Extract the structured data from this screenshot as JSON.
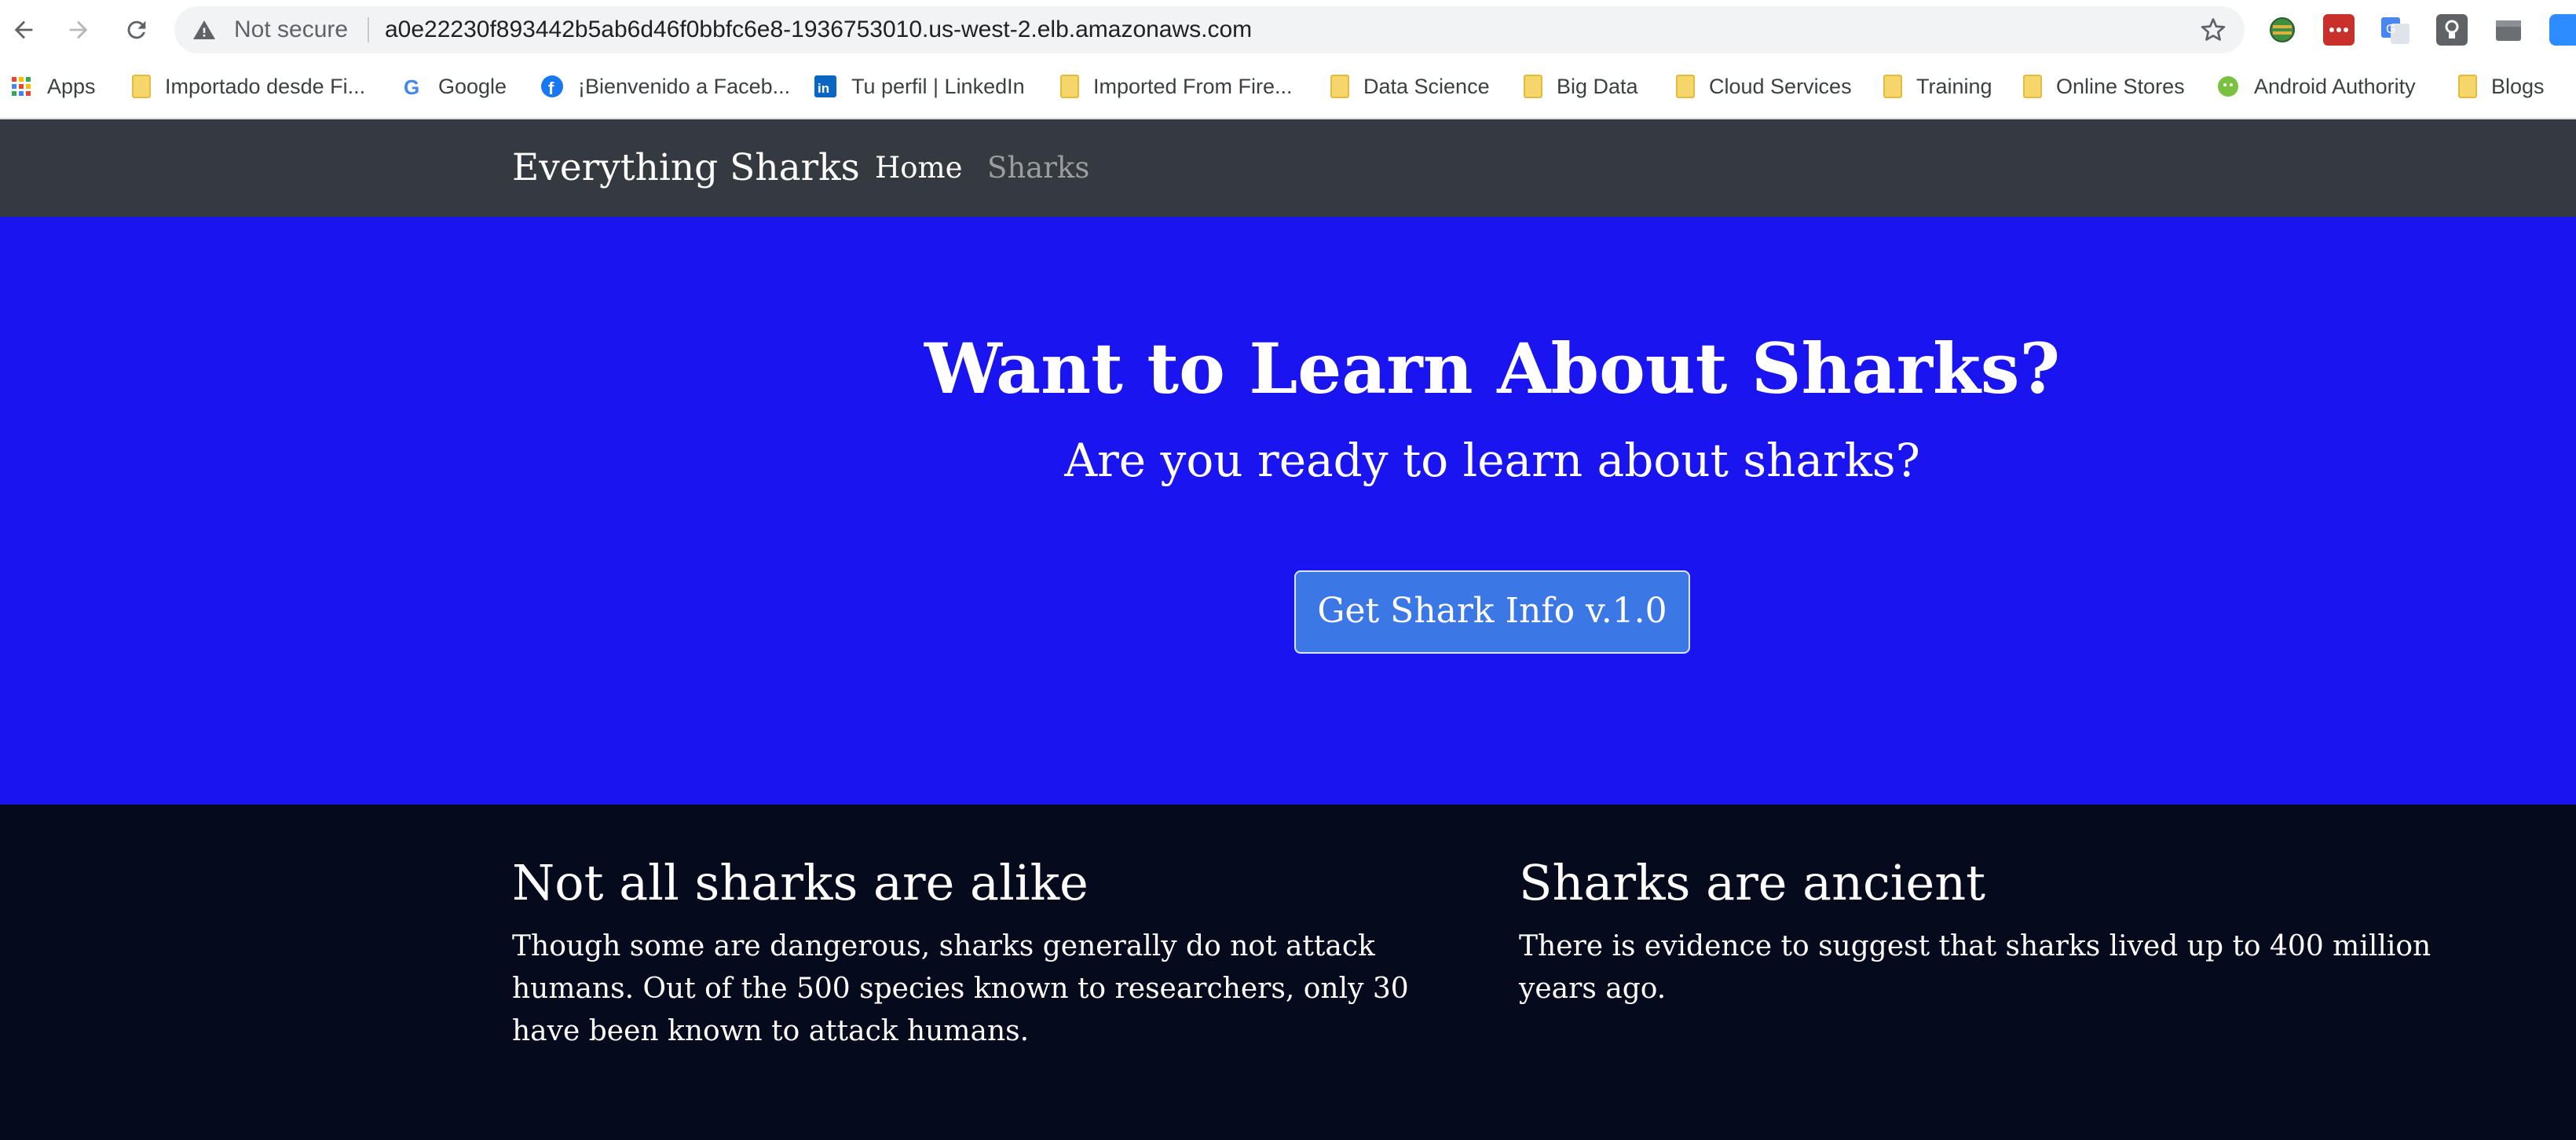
{
  "browser": {
    "security_label": "Not secure",
    "url": "a0e22230f893442b5ab6d46f0bbfc6e8-1936753010.us-west-2.elb.amazonaws.com",
    "icons": [
      "back-icon",
      "forward-icon",
      "reload-icon",
      "warning-icon",
      "star-icon"
    ],
    "extensions": [
      "globe-extension-icon",
      "lastpass-icon",
      "google-translate-icon",
      "keep-icon",
      "box-extension-icon",
      "zoom-icon"
    ],
    "bookmarks": [
      {
        "label": "Apps",
        "icon": "apps-grid-icon"
      },
      {
        "label": "Importado desde Fi...",
        "icon": "folder-icon"
      },
      {
        "label": "Google",
        "icon": "google-icon"
      },
      {
        "label": "¡Bienvenido a Faceb...",
        "icon": "facebook-icon"
      },
      {
        "label": "Tu perfil | LinkedIn",
        "icon": "linkedin-icon"
      },
      {
        "label": "Imported From Fire...",
        "icon": "folder-icon"
      },
      {
        "label": "Data Science",
        "icon": "folder-icon"
      },
      {
        "label": "Big Data",
        "icon": "folder-icon"
      },
      {
        "label": "Cloud Services",
        "icon": "folder-icon"
      },
      {
        "label": "Training",
        "icon": "folder-icon"
      },
      {
        "label": "Online Stores",
        "icon": "folder-icon"
      },
      {
        "label": "Android Authority",
        "icon": "android-icon"
      },
      {
        "label": "Blogs",
        "icon": "folder-icon"
      }
    ]
  },
  "navbar": {
    "brand": "Everything Sharks",
    "links": [
      {
        "label": "Home",
        "active": true
      },
      {
        "label": "Sharks",
        "active": false
      }
    ]
  },
  "hero": {
    "title": "Want to Learn About Sharks?",
    "subtitle": "Are you ready to learn about sharks?",
    "button_label": "Get Shark Info v.1.0",
    "background_color": "#1a15f0",
    "button_color": "#3b78e6"
  },
  "facts": [
    {
      "heading": "Not all sharks are alike",
      "body": "Though some are dangerous, sharks generally do not attack humans. Out of the 500 species known to researchers, only 30 have been known to attack humans."
    },
    {
      "heading": "Sharks are ancient",
      "body": "There is evidence to suggest that sharks lived up to 400 million years ago."
    }
  ],
  "colors": {
    "navbar": "#343a40",
    "footer_section": "#060a1d",
    "nav_inactive": "#9a9da1"
  }
}
